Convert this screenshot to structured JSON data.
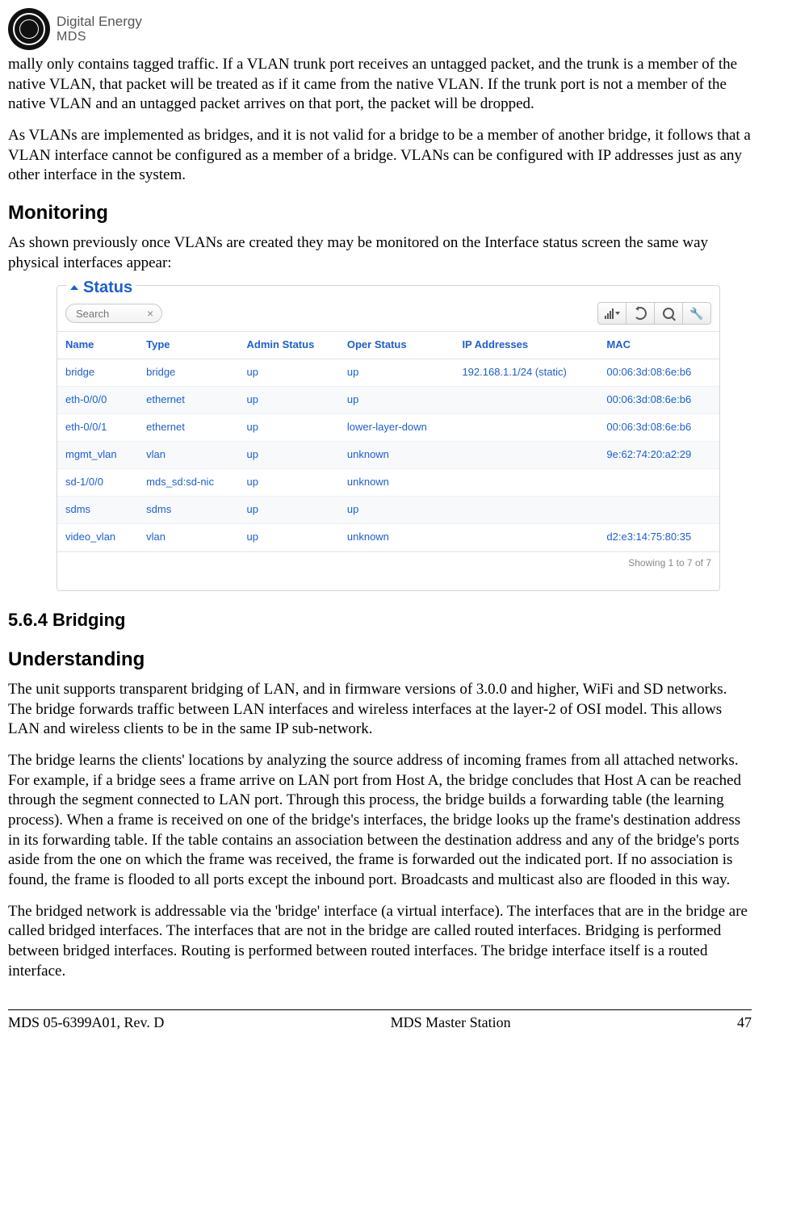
{
  "logo": {
    "line1": "Digital Energy",
    "line2": "MDS"
  },
  "paragraphs": {
    "p1": "mally only contains tagged traffic. If a VLAN trunk port receives an untagged packet, and the trunk is a member of the native VLAN, that packet will be treated as if it came from the native VLAN. If the trunk port is not a member of the native VLAN and an untagged packet arrives on that port, the packet will be dropped.",
    "p2": "As VLANs are implemented as bridges, and it is not valid for a bridge to be a member of another bridge, it follows that a VLAN interface cannot be configured as a member of a bridge. VLANs can be configured with IP addresses just as any other interface in the system.",
    "monitoring_intro": "As shown previously once VLANs are created they may be monitored on the Interface status screen the same way physical interfaces appear:",
    "understanding_p1": "The unit supports transparent bridging of LAN, and in firmware versions of 3.0.0 and higher, WiFi and SD networks. The bridge forwards traffic between LAN interfaces and wireless interfaces at the layer-2 of OSI model. This allows LAN and wireless clients to be in the same IP sub-network.",
    "understanding_p2": "The bridge learns the clients' locations by analyzing the source address of incoming frames from all attached networks. For example, if a bridge sees a frame arrive on LAN port from Host A, the bridge concludes that Host A can be reached through the segment connected to LAN port. Through this process, the bridge builds a forwarding table (the learning process). When a frame is received on one of the bridge's interfaces, the bridge looks up the frame's destination address in its forwarding table. If the table contains an association between the destination address and any of the bridge's ports aside from the one on which the frame was received, the frame is forwarded out the indicated port. If no association is found, the frame is flooded to all ports except the inbound port. Broadcasts and multicast also are flooded in this way.",
    "understanding_p3": "The bridged network is addressable via the 'bridge' interface (a virtual interface). The interfaces that are in the bridge are called bridged interfaces. The interfaces that are not in the bridge are called routed interfaces. Bridging is performed between bridged interfaces. Routing is performed between routed interfaces. The bridge interface itself is a routed interface."
  },
  "headings": {
    "monitoring": "Monitoring",
    "bridging": "5.6.4 Bridging",
    "understanding": "Understanding"
  },
  "status_panel": {
    "title": "Status",
    "search_placeholder": "Search",
    "headers": [
      "Name",
      "Type",
      "Admin Status",
      "Oper Status",
      "IP Addresses",
      "MAC"
    ],
    "rows": [
      {
        "name": "bridge",
        "type": "bridge",
        "admin": "up",
        "oper": "up",
        "ip": "192.168.1.1/24 (static)",
        "mac": "00:06:3d:08:6e:b6"
      },
      {
        "name": "eth-0/0/0",
        "type": "ethernet",
        "admin": "up",
        "oper": "up",
        "ip": "",
        "mac": "00:06:3d:08:6e:b6"
      },
      {
        "name": "eth-0/0/1",
        "type": "ethernet",
        "admin": "up",
        "oper": "lower-layer-down",
        "ip": "",
        "mac": "00:06:3d:08:6e:b6"
      },
      {
        "name": "mgmt_vlan",
        "type": "vlan",
        "admin": "up",
        "oper": "unknown",
        "ip": "",
        "mac": "9e:62:74:20:a2:29"
      },
      {
        "name": "sd-1/0/0",
        "type": "mds_sd:sd-nic",
        "admin": "up",
        "oper": "unknown",
        "ip": "",
        "mac": ""
      },
      {
        "name": "sdms",
        "type": "sdms",
        "admin": "up",
        "oper": "up",
        "ip": "",
        "mac": ""
      },
      {
        "name": "video_vlan",
        "type": "vlan",
        "admin": "up",
        "oper": "unknown",
        "ip": "",
        "mac": "d2:e3:14:75:80:35"
      }
    ],
    "footer": "Showing 1 to 7 of 7"
  },
  "page_footer": {
    "left": "MDS 05-6399A01, Rev. D",
    "center": "MDS Master Station",
    "right": "47"
  }
}
